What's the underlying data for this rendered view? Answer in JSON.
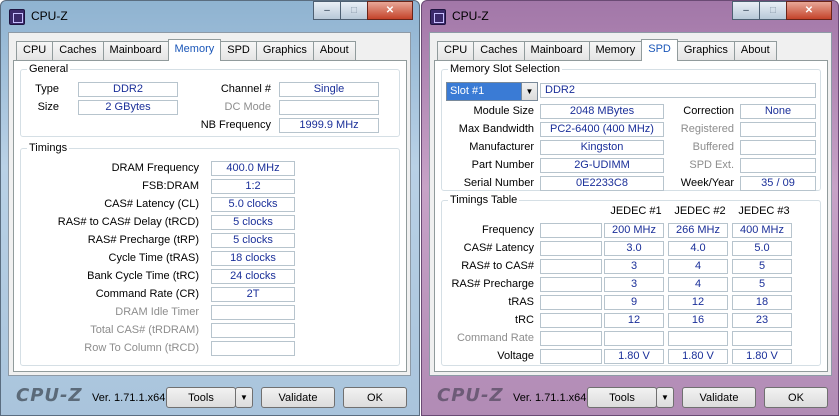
{
  "left": {
    "title": "CPU-Z",
    "tabs": [
      "CPU",
      "Caches",
      "Mainboard",
      "Memory",
      "SPD",
      "Graphics",
      "About"
    ],
    "active_tab": "Memory",
    "general": {
      "title": "General",
      "type_label": "Type",
      "type_value": "DDR2",
      "size_label": "Size",
      "size_value": "2 GBytes",
      "channel_label": "Channel #",
      "channel_value": "Single",
      "dc_mode_label": "DC Mode",
      "dc_mode_value": "",
      "nb_freq_label": "NB Frequency",
      "nb_freq_value": "1999.9 MHz"
    },
    "timings": {
      "title": "Timings",
      "rows": [
        {
          "label": "DRAM Frequency",
          "value": "400.0 MHz",
          "disabled": false
        },
        {
          "label": "FSB:DRAM",
          "value": "1:2",
          "disabled": false
        },
        {
          "label": "CAS# Latency (CL)",
          "value": "5.0 clocks",
          "disabled": false
        },
        {
          "label": "RAS# to CAS# Delay (tRCD)",
          "value": "5 clocks",
          "disabled": false
        },
        {
          "label": "RAS# Precharge (tRP)",
          "value": "5 clocks",
          "disabled": false
        },
        {
          "label": "Cycle Time (tRAS)",
          "value": "18 clocks",
          "disabled": false
        },
        {
          "label": "Bank Cycle Time (tRC)",
          "value": "24 clocks",
          "disabled": false
        },
        {
          "label": "Command Rate (CR)",
          "value": "2T",
          "disabled": false
        },
        {
          "label": "DRAM Idle Timer",
          "value": "",
          "disabled": true
        },
        {
          "label": "Total CAS# (tRDRAM)",
          "value": "",
          "disabled": true
        },
        {
          "label": "Row To Column (tRCD)",
          "value": "",
          "disabled": true
        }
      ]
    },
    "footer": {
      "brand": "CPU-Z",
      "version": "Ver. 1.71.1.x64",
      "tools": "Tools",
      "validate": "Validate",
      "ok": "OK"
    }
  },
  "right": {
    "title": "CPU-Z",
    "tabs": [
      "CPU",
      "Caches",
      "Mainboard",
      "Memory",
      "SPD",
      "Graphics",
      "About"
    ],
    "active_tab": "SPD",
    "slot": {
      "title": "Memory Slot Selection",
      "selected": "Slot #1",
      "type_value": "DDR2",
      "module_size_label": "Module Size",
      "module_size_value": "2048 MBytes",
      "max_bw_label": "Max Bandwidth",
      "max_bw_value": "PC2-6400 (400 MHz)",
      "manufacturer_label": "Manufacturer",
      "manufacturer_value": "Kingston",
      "part_label": "Part Number",
      "part_value": "2G-UDIMM",
      "serial_label": "Serial Number",
      "serial_value": "0E2233C8",
      "correction_label": "Correction",
      "correction_value": "None",
      "registered_label": "Registered",
      "registered_value": "",
      "buffered_label": "Buffered",
      "buffered_value": "",
      "spd_ext_label": "SPD Ext.",
      "spd_ext_value": "",
      "week_year_label": "Week/Year",
      "week_year_value": "35 / 09"
    },
    "timings_table": {
      "title": "Timings Table",
      "columns": [
        "JEDEC #1",
        "JEDEC #2",
        "JEDEC #3"
      ],
      "rows": [
        {
          "label": "Frequency",
          "values": [
            "200 MHz",
            "266 MHz",
            "400 MHz"
          ],
          "disabled": false
        },
        {
          "label": "CAS# Latency",
          "values": [
            "3.0",
            "4.0",
            "5.0"
          ],
          "disabled": false
        },
        {
          "label": "RAS# to CAS#",
          "values": [
            "3",
            "4",
            "5"
          ],
          "disabled": false
        },
        {
          "label": "RAS# Precharge",
          "values": [
            "3",
            "4",
            "5"
          ],
          "disabled": false
        },
        {
          "label": "tRAS",
          "values": [
            "9",
            "12",
            "18"
          ],
          "disabled": false
        },
        {
          "label": "tRC",
          "values": [
            "12",
            "16",
            "23"
          ],
          "disabled": false
        },
        {
          "label": "Command Rate",
          "values": [
            "",
            "",
            ""
          ],
          "disabled": true
        },
        {
          "label": "Voltage",
          "values": [
            "1.80 V",
            "1.80 V",
            "1.80 V"
          ],
          "disabled": false
        }
      ]
    },
    "footer": {
      "brand": "CPU-Z",
      "version": "Ver. 1.71.1.x64",
      "tools": "Tools",
      "validate": "Validate",
      "ok": "OK"
    }
  },
  "caption": {
    "min": "–",
    "max": "□",
    "close": "✕"
  },
  "icons": {
    "app": "cpu-z-app-icon",
    "dropdown": "chevron-down-icon"
  }
}
